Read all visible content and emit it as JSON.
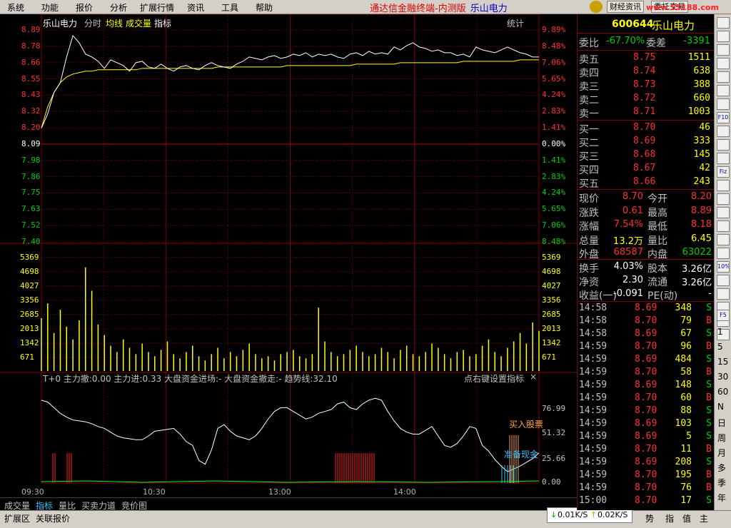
{
  "menubar": {
    "items": [
      "系统",
      "功能",
      "报价",
      "分析",
      "扩展行情",
      "资讯",
      "工具",
      "帮助"
    ],
    "app_title": "通达信金融终端-内测版",
    "stock_name": "乐山电力",
    "buttons": [
      "财经资讯",
      "委托交易"
    ],
    "watermark": "www.55188.com"
  },
  "chart_header": {
    "stock": "乐山电力",
    "tab_fenshi": "分时",
    "tab_junxian": "均线",
    "tab_volume": "成交量",
    "tab_indicator": "指标",
    "stats_btn": "统计"
  },
  "price_axis_left": [
    "8.89",
    "8.78",
    "8.66",
    "8.55",
    "8.43",
    "8.32",
    "8.20",
    "8.09",
    "7.98",
    "7.86",
    "7.75",
    "7.63",
    "7.52",
    "7.40"
  ],
  "price_axis_right": [
    "9.89%",
    "8.48%",
    "7.06%",
    "5.65%",
    "4.24%",
    "2.83%",
    "1.41%",
    "0.00%",
    "1.41%",
    "2.83%",
    "4.24%",
    "5.65%",
    "7.06%",
    "8.48%"
  ],
  "volume_axis": [
    "5369",
    "4698",
    "4027",
    "3356",
    "2685",
    "2013",
    "1342",
    "671"
  ],
  "indicator_header": {
    "text": "T+0 主力撤:0.00 主力进:0.33 大盘资金进场:- 大盘资金撤走:- 趋势线:32.10",
    "right_text": "点右键设置指标",
    "close": "×"
  },
  "indicator_axis": [
    "76.99",
    "51.32",
    "25.66",
    "0.00"
  ],
  "indicator_annotations": {
    "buy": "买入股票",
    "ready": "准备现金"
  },
  "time_axis": [
    "09:30",
    "10:30",
    "13:00",
    "14:00"
  ],
  "bottom_tabs": [
    "成交量",
    "指标",
    "量比",
    "买卖力道",
    "竞价图"
  ],
  "status_tabs": [
    "扩展区",
    "关联报价"
  ],
  "net_speed": {
    "down": "0.01K/S",
    "up": "0.02K/S"
  },
  "panel_tabs": [
    "势",
    "指",
    "值",
    "主"
  ],
  "quote": {
    "code": "600644",
    "name": "乐山电力",
    "weibi_label": "委比",
    "weibi": "-67.70%",
    "weicha_label": "委差",
    "weicha": "-3391",
    "sells": [
      {
        "label": "卖五",
        "price": "8.75",
        "vol": "1511"
      },
      {
        "label": "卖四",
        "price": "8.74",
        "vol": "638"
      },
      {
        "label": "卖三",
        "price": "8.73",
        "vol": "388"
      },
      {
        "label": "卖二",
        "price": "8.72",
        "vol": "660"
      },
      {
        "label": "卖一",
        "price": "8.71",
        "vol": "1003"
      }
    ],
    "buys": [
      {
        "label": "买一",
        "price": "8.70",
        "vol": "46"
      },
      {
        "label": "买二",
        "price": "8.69",
        "vol": "333"
      },
      {
        "label": "买三",
        "price": "8.68",
        "vol": "145"
      },
      {
        "label": "买四",
        "price": "8.67",
        "vol": "42"
      },
      {
        "label": "买五",
        "price": "8.66",
        "vol": "243"
      }
    ],
    "stats": [
      [
        {
          "l": "现价",
          "v": "8.70",
          "c": "#ff3030"
        },
        {
          "l": "今开",
          "v": "8.20",
          "c": "#ff3030"
        }
      ],
      [
        {
          "l": "涨跌",
          "v": "0.61",
          "c": "#ff3030"
        },
        {
          "l": "最高",
          "v": "8.89",
          "c": "#ff3030"
        }
      ],
      [
        {
          "l": "涨幅",
          "v": "7.54%",
          "c": "#ff3030"
        },
        {
          "l": "最低",
          "v": "8.18",
          "c": "#ff3030"
        }
      ],
      [
        {
          "l": "总量",
          "v": "13.2万",
          "c": "#ffff00"
        },
        {
          "l": "量比",
          "v": "6.45",
          "c": "#ffff00"
        }
      ],
      [
        {
          "l": "外盘",
          "v": "68587",
          "c": "#ff3030"
        },
        {
          "l": "内盘",
          "v": "63022",
          "c": "#00d000"
        }
      ]
    ],
    "stats2": [
      [
        {
          "l": "换手",
          "v": "4.03%",
          "c": "#ffffff"
        },
        {
          "l": "股本",
          "v": "3.26亿",
          "c": "#ffffff"
        }
      ],
      [
        {
          "l": "净资",
          "v": "2.30",
          "c": "#ffffff"
        },
        {
          "l": "流通",
          "v": "3.26亿",
          "c": "#ffffff"
        }
      ],
      [
        {
          "l": "收益(一)",
          "v": "-0.091",
          "c": "#ffffff"
        },
        {
          "l": "PE(动)",
          "v": "-",
          "c": "#ffffff"
        }
      ]
    ],
    "ticks": [
      {
        "t": "14:58",
        "p": "8.69",
        "v": "348",
        "d": "S"
      },
      {
        "t": "14:58",
        "p": "8.70",
        "v": "79",
        "d": "B"
      },
      {
        "t": "14:58",
        "p": "8.69",
        "v": "67",
        "d": "S"
      },
      {
        "t": "14:59",
        "p": "8.70",
        "v": "96",
        "d": "B"
      },
      {
        "t": "14:59",
        "p": "8.69",
        "v": "484",
        "d": "S"
      },
      {
        "t": "14:59",
        "p": "8.70",
        "v": "58",
        "d": "B"
      },
      {
        "t": "14:59",
        "p": "8.69",
        "v": "148",
        "d": "S"
      },
      {
        "t": "14:59",
        "p": "8.70",
        "v": "60",
        "d": "B"
      },
      {
        "t": "14:59",
        "p": "8.70",
        "v": "88",
        "d": "S"
      },
      {
        "t": "14:59",
        "p": "8.69",
        "v": "103",
        "d": "S"
      },
      {
        "t": "14:59",
        "p": "8.69",
        "v": "5",
        "d": "S"
      },
      {
        "t": "14:59",
        "p": "8.70",
        "v": "11",
        "d": "B"
      },
      {
        "t": "14:59",
        "p": "8.69",
        "v": "208",
        "d": "S"
      },
      {
        "t": "14:59",
        "p": "8.70",
        "v": "195",
        "d": "B"
      },
      {
        "t": "14:59",
        "p": "8.70",
        "v": "76",
        "d": "B"
      },
      {
        "t": "15:00",
        "p": "8.70",
        "v": "17",
        "d": "S"
      }
    ]
  },
  "right_toolbar_text": [
    "1",
    "5",
    "15",
    "30",
    "60",
    "N",
    "日",
    "周",
    "月",
    "多",
    "季",
    "年"
  ],
  "right_toolbar_icons": [
    "F10",
    "F5",
    "10%",
    "Fiz"
  ],
  "chart_data": {
    "type": "line",
    "price_range": [
      7.4,
      8.89
    ],
    "prev_close": 8.09,
    "price": [
      8.2,
      8.3,
      8.45,
      8.52,
      8.7,
      8.85,
      8.8,
      8.72,
      8.7,
      8.67,
      8.62,
      8.68,
      8.66,
      8.64,
      8.6,
      8.66,
      8.67,
      8.63,
      8.62,
      8.65,
      8.62,
      8.6,
      8.63,
      8.64,
      8.62,
      8.61,
      8.64,
      8.66,
      8.64,
      8.63,
      8.62,
      8.65,
      8.67,
      8.7,
      8.69,
      8.68,
      8.7,
      8.71,
      8.69,
      8.7,
      8.72,
      8.71,
      8.73,
      8.7,
      8.72,
      8.71,
      8.72,
      8.7,
      8.69,
      8.72,
      8.73,
      8.71,
      8.74,
      8.72,
      8.73,
      8.72,
      8.77,
      8.75,
      8.78,
      8.8,
      8.77,
      8.76,
      8.74,
      8.75,
      8.73,
      8.73,
      8.71,
      8.72,
      8.7,
      8.77,
      8.75,
      8.74,
      8.73,
      8.75,
      8.77,
      8.75,
      8.73,
      8.72,
      8.7,
      8.7
    ],
    "avg": [
      8.2,
      8.35,
      8.45,
      8.52,
      8.56,
      8.58,
      8.59,
      8.6,
      8.6,
      8.61,
      8.61,
      8.61,
      8.61,
      8.61,
      8.61,
      8.61,
      8.62,
      8.62,
      8.62,
      8.62,
      8.62,
      8.62,
      8.62,
      8.62,
      8.62,
      8.62,
      8.62,
      8.62,
      8.63,
      8.63,
      8.63,
      8.63,
      8.63,
      8.63,
      8.63,
      8.63,
      8.63,
      8.63,
      8.63,
      8.64,
      8.64,
      8.64,
      8.64,
      8.64,
      8.64,
      8.64,
      8.64,
      8.64,
      8.64,
      8.64,
      8.65,
      8.65,
      8.65,
      8.65,
      8.65,
      8.65,
      8.65,
      8.66,
      8.66,
      8.66,
      8.66,
      8.66,
      8.66,
      8.66,
      8.66,
      8.66,
      8.66,
      8.67,
      8.67,
      8.67,
      8.67,
      8.67,
      8.67,
      8.67,
      8.67,
      8.67,
      8.68,
      8.68,
      8.68,
      8.68
    ],
    "volume_range": [
      0,
      5369
    ],
    "volume": [
      2500,
      3200,
      1800,
      2900,
      2100,
      1500,
      2400,
      4900,
      3800,
      2200,
      1700,
      1200,
      900,
      1500,
      1100,
      800,
      1300,
      900,
      700,
      1000,
      1400,
      800,
      600,
      900,
      1200,
      700,
      500,
      800,
      1100,
      600,
      900,
      700,
      1000,
      1300,
      800,
      600,
      700,
      500,
      800,
      900,
      1000,
      700,
      600,
      800,
      3000,
      1400,
      900,
      700,
      800,
      1000,
      1200,
      900,
      700,
      800,
      1100,
      900,
      600,
      1000,
      1200,
      800,
      700,
      900,
      1300,
      1100,
      800,
      600,
      900,
      1000,
      700,
      800,
      1200,
      1500,
      900,
      700,
      1100,
      1400,
      1800,
      1300,
      2300,
      1900
    ],
    "indicator_range": [
      0,
      100
    ],
    "indicator": [
      88,
      86,
      80,
      74,
      70,
      67,
      66,
      65,
      63,
      60,
      58,
      54,
      50,
      48,
      47,
      46,
      46,
      50,
      55,
      56,
      57,
      58,
      52,
      44,
      40,
      24,
      20,
      35,
      58,
      62,
      55,
      50,
      48,
      46,
      50,
      58,
      68,
      76,
      80,
      80,
      76,
      72,
      68,
      70,
      74,
      76,
      78,
      84,
      86,
      80,
      78,
      84,
      88,
      90,
      88,
      76,
      66,
      58,
      54,
      52,
      52,
      56,
      60,
      50,
      40,
      38,
      42,
      50,
      60,
      58,
      40,
      34,
      25,
      18,
      12,
      15,
      18,
      22,
      26,
      32
    ]
  }
}
